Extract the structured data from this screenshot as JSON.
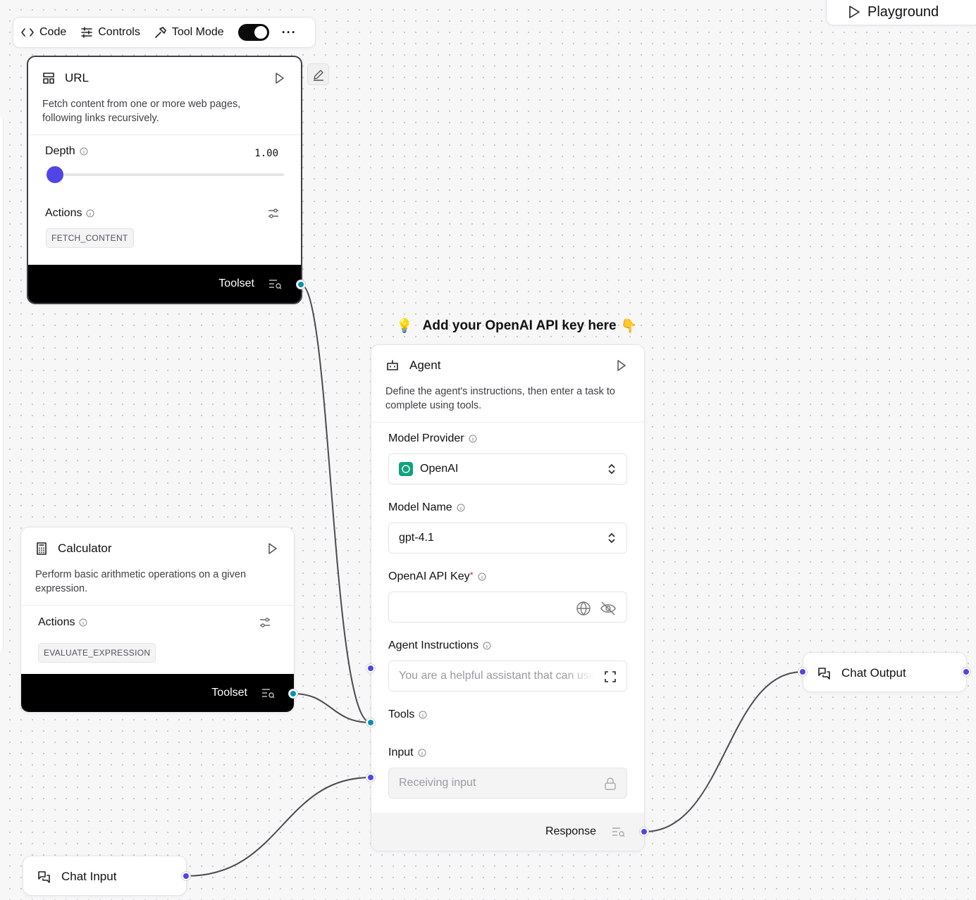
{
  "toolbar": {
    "code": "Code",
    "controls": "Controls",
    "tool_mode": "Tool Mode",
    "tool_mode_on": true,
    "more": "···"
  },
  "playground": {
    "label": "Playground"
  },
  "note": {
    "bulb": "💡",
    "text": "Add your OpenAI API key here",
    "hand": "👇"
  },
  "url_node": {
    "title": "URL",
    "description": "Fetch content from one or more web pages, following links recursively.",
    "depth_label": "Depth",
    "depth_value": "1.00",
    "actions_label": "Actions",
    "action_chip": "FETCH_CONTENT",
    "footer_label": "Toolset"
  },
  "calculator_node": {
    "title": "Calculator",
    "description": "Perform basic arithmetic operations on a given expression.",
    "actions_label": "Actions",
    "action_chip": "EVALUATE_EXPRESSION",
    "footer_label": "Toolset"
  },
  "agent_node": {
    "title": "Agent",
    "description": "Define the agent's instructions, then enter a task to complete using tools.",
    "model_provider_label": "Model Provider",
    "model_provider_value": "OpenAI",
    "model_name_label": "Model Name",
    "model_name_value": "gpt-4.1",
    "api_key_label": "OpenAI API Key",
    "api_key_required": "*",
    "api_key_value": "",
    "instructions_label": "Agent Instructions",
    "instructions_value": "You are a helpful assistant that can use tools",
    "tools_label": "Tools",
    "input_label": "Input",
    "input_placeholder": "Receiving input",
    "footer_label": "Response"
  },
  "chat_output_node": {
    "title": "Chat Output"
  },
  "chat_input_node": {
    "title": "Chat Input"
  },
  "colors": {
    "teal_handle": "#0891b2",
    "blue_handle": "#4f46e5",
    "slider_thumb": "#4f46e5",
    "openai_green": "#10a37f"
  }
}
